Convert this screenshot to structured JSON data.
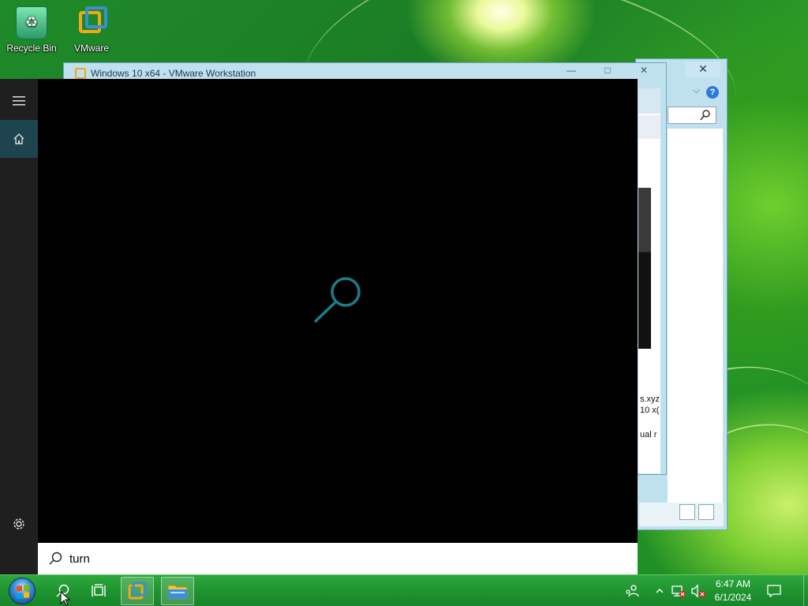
{
  "desktop": {
    "icons": [
      {
        "label": "Recycle Bin",
        "icon": "recycle-bin-icon"
      },
      {
        "label": "VMware",
        "icon": "vmware-icon"
      }
    ]
  },
  "background_windows": {
    "vmware_title": "Windows 10 x64 - VMware Workstation",
    "fragments": [
      "s.xyz",
      "10 x(",
      "ual r"
    ]
  },
  "start_menu": {
    "rail": {
      "menu_icon": "hamburger-icon",
      "home_icon": "home-icon",
      "settings_icon": "gear-icon"
    },
    "search_illustration_icon": "search-icon",
    "search_box": {
      "value": "turn",
      "icon": "search-icon"
    }
  },
  "taskbar": {
    "start_button_icon": "windows-orb-icon",
    "search_icon": "search-icon",
    "task_view_icon": "task-view-icon",
    "pinned_apps": [
      {
        "name": "vmware",
        "icon": "vmware-icon",
        "active": true
      },
      {
        "name": "file-explorer",
        "icon": "folder-icon",
        "active": false
      }
    ],
    "tray": {
      "people_icon": "people-icon",
      "chevron_icon": "chevron-up-icon",
      "network_icon": "network-error-icon",
      "volume_icon": "volume-muted-icon",
      "time": "6:47 AM",
      "date": "6/1/2024",
      "notification_icon": "notification-icon"
    }
  },
  "colors": {
    "accent": "#1e4450",
    "search_accent": "#1a7d8a",
    "taskbar": "#1f9430"
  }
}
